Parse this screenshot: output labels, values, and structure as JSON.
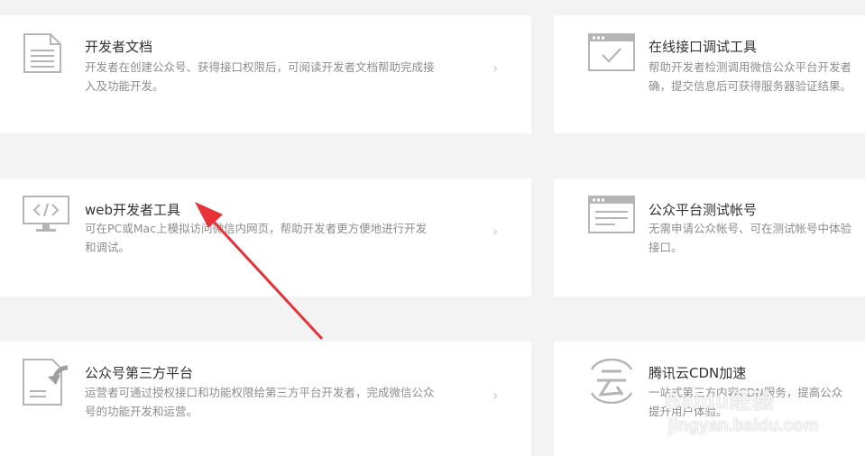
{
  "cards": [
    {
      "title": "开发者文档",
      "desc1": "开发者在创建公众号、获得接口权限后，可阅读开发者文档帮助完成接",
      "desc2": "入及功能开发。",
      "icon": "document-icon"
    },
    {
      "title": "在线接口调试工具",
      "desc1": "帮助开发者检测调用微信公众平台开发者",
      "desc2": "确，提交信息后可获得服务器验证结果。",
      "icon": "debug-check-icon"
    },
    {
      "title": "web开发者工具",
      "desc1": "可在PC或Mac上模拟访问微信内网页，帮助开发者更方便地进行开发",
      "desc2": "和调试。",
      "icon": "monitor-code-icon"
    },
    {
      "title": "公众平台测试帐号",
      "desc1": "无需申请公众帐号、可在测试帐号中体验",
      "desc2": "接口。",
      "icon": "test-account-icon"
    },
    {
      "title": "公众号第三方平台",
      "desc1": "运营者可通过授权接口和功能权限给第三方平台开发者，完成微信公众",
      "desc2": "号的功能开发和运营。",
      "icon": "third-party-icon"
    },
    {
      "title": "腾讯云CDN加速",
      "desc1": "一站式第三方内容CDN服务，提高公众",
      "desc2": "提升用户体验。",
      "icon": "cloud-yun-icon"
    }
  ],
  "chevron": "›",
  "watermark": {
    "line1": "Baidu经验",
    "line2": "jingyan.baidu.com"
  },
  "annotation": {
    "color": "#e8323a"
  }
}
